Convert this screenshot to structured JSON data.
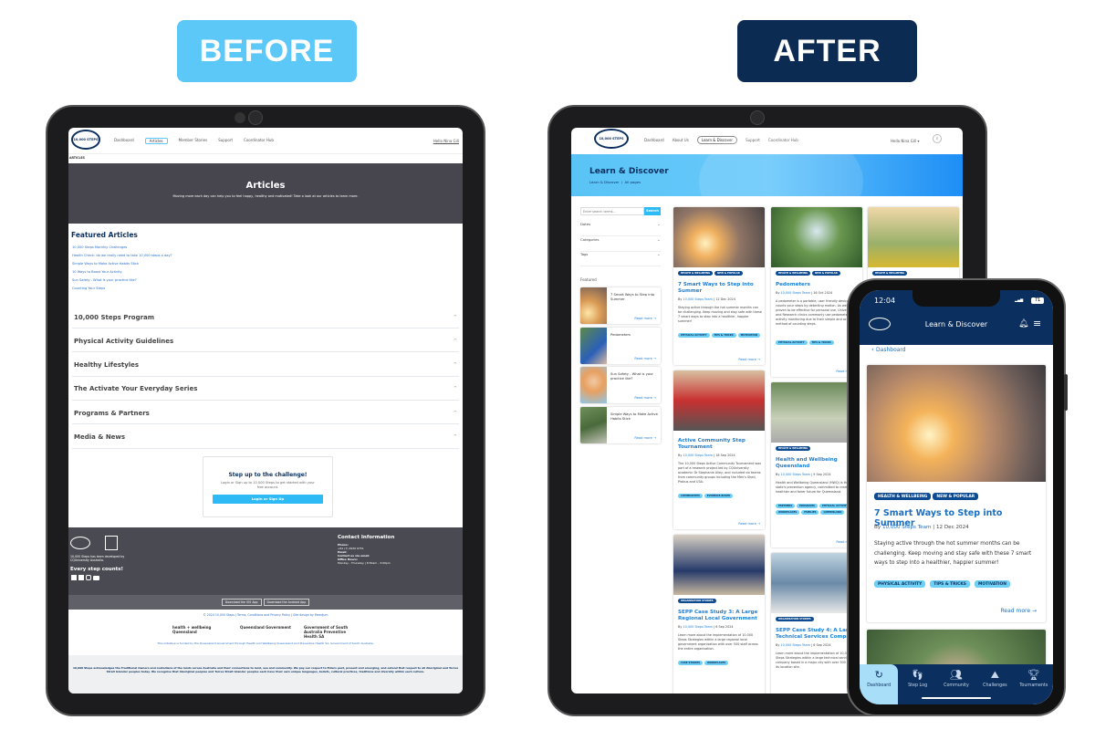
{
  "labels": {
    "before": "BEFORE",
    "after": "AFTER"
  },
  "colors": {
    "before_badge": "#5cc8f7",
    "after_badge": "#0c2b52",
    "navy": "#0b2f5e",
    "accent": "#1b7fd4",
    "cyan": "#2ebbf5",
    "dark_hero": "#47464f"
  },
  "old_site": {
    "logo": "10,000 STEPS",
    "nav": [
      "Dashboard",
      "Articles",
      "Member Stories",
      "Support",
      "Coordinator Hub"
    ],
    "user": "Hello Nina Gill",
    "breadcrumb": "ARTICLES",
    "hero": {
      "title": "Articles",
      "subtitle": "Moving more each day can help you to feel happy, healthy and motivated! Take a look at our articles to learn more."
    },
    "featured": {
      "title": "Featured Articles",
      "links": [
        "10,000 Steps Monthly Challenges",
        "Health Check: do we really need to take 10,000 steps a day?",
        "Simple Ways to Make Active Habits Stick",
        "10 Ways to Boost Your Activity",
        "Sun Safety - What is your practice like?",
        "Counting Your Steps"
      ]
    },
    "accordion": [
      "10,000 Steps Program",
      "Physical Activity Guidelines",
      "Healthy Lifestyles",
      "The Activate Your Everyday Series",
      "Programs & Partners",
      "Media & News"
    ],
    "cta": {
      "title": "Step up to the challenge!",
      "text": "Login or Sign up to 10,000 Steps to get started with your free account.",
      "button": "Login or Sign Up"
    },
    "footer": {
      "developed": "10,000 Steps has been developed by CQUniversity Australia.",
      "tagline": "Every step counts!",
      "contact_title": "Contact Information",
      "phone_label": "Phone:",
      "phone": "+61 (7) 4930 6751",
      "email_label": "Email:",
      "email": "Contact us via email",
      "hours_label": "Office Hours:",
      "hours": "Monday - Thursday | 8:30am - 3:00pm",
      "ios": "Download the iOS App",
      "android": "Download the Android App",
      "copyright": "© 2024 10,000 Steps | Terms, Conditions and Privacy Policy | Site design by Meedjum",
      "logos": [
        "health + wellbeing Queensland",
        "Queensland Government",
        "Government of South Australia Preventive Health SA"
      ],
      "funded": "This initiative is funded by the Queensland Government through Health and Wellbeing Queensland and Preventive Health SA, Government of South Australia.",
      "ack": "10,000 Steps acknowledges the Traditional Owners and custodians of the lands across Australia and their connections to land, sea and community. We pay our respect to Elders past, present and emerging, and extend that respect to all Aboriginal and Torres Strait Islander peoples today. We recognise that Aboriginal peoples and Torres Strait Islander peoples each have their own unique languages, beliefs, cultural practices, traditions and diversity within each culture."
    }
  },
  "new_site": {
    "nav": [
      "Dashboard",
      "About Us",
      "Learn & Discover",
      "Support",
      "Coordinator Hub"
    ],
    "user": "Hello Nina Gill",
    "hero": {
      "title": "Learn & Discover",
      "breadcrumb": "Learn & Discover  /  All pages"
    },
    "search": {
      "placeholder": "Enter search terms...",
      "button": "Search"
    },
    "filters": [
      "Dates",
      "Categories",
      "Tags"
    ],
    "featured_title": "Featured",
    "featured": [
      {
        "title": "7 Smart Ways to Step into Summer"
      },
      {
        "title": "Pedometers"
      },
      {
        "title": "Sun Safety - What is your practice like?"
      },
      {
        "title": "Simple Ways to Make Active Habits Stick"
      }
    ],
    "read_more": "Read more →",
    "cards": [
      {
        "tags": [
          "HEALTH & WELLBEING",
          "NEW & POPULAR"
        ],
        "title": "7 Smart Ways to Step into Summer",
        "author": "10,000 Steps Team",
        "date": "12 Dec 2024",
        "desc": "Staying active through the hot summer months can be challenging. Keep moving and stay safe with these 7 smart ways to step into a healthier, happier summer!",
        "topics": [
          "PHYSICAL ACTIVITY",
          "TIPS & TRICKS",
          "MOTIVATION"
        ]
      },
      {
        "tags": [
          "HEALTH & WELLBEING",
          "NEW & POPULAR"
        ],
        "title": "Pedometers",
        "author": "10,000 Steps Team",
        "date": "16 Oct 2024",
        "desc": "A pedometer is a portable, user friendly device that counts your steps by detecting motion. As well as proven to be effective for personal use, Universities and Research clinics commonly use pedometers for activity monitoring due to their simple and accurate method of counting steps.",
        "topics": [
          "PHYSICAL ACTIVITY",
          "TIPS & TRICKS"
        ]
      },
      {
        "tags": [
          "HEALTH & WELLBEING"
        ]
      },
      {
        "tags": [],
        "title": "Active Community Step Tournament",
        "author": "10,000 Steps Team",
        "date": "18 Sep 2024",
        "desc": "The 10,000 Steps Active Community Tournament was part of a research project led by CQUniversity academic Dr Stephanie Alley, and included six teams from community groups including the Men's Shed, Probus and U3A.",
        "topics": [
          "COMMUNITIES",
          "EVIDENCE-BASED"
        ]
      },
      {
        "tags": [
          "HEALTH & WELLBEING"
        ],
        "title": "Health and Wellbeing Queensland",
        "author": "10,000 Steps Team",
        "date": "9 Sep 2024",
        "desc": "Health and Wellbeing Queensland (HWQ) is the state's prevention agency, committed to creating a healthier and fairer future for Queensland.",
        "topics": [
          "PARTNERS",
          "PROGRAMS",
          "PHYSICAL ACTIVITY",
          "WORKPLACES",
          "FAMILIES",
          "QUEENSLAND"
        ]
      },
      {
        "tags": [
          "ORGANISATION STORIES"
        ],
        "title": "SEPP Case Study 3: A Large Regional Local Government",
        "author": "10,000 Steps Team",
        "date": "6 Sep 2024",
        "desc": "Learn more about the implementation of 10,000 Steps Strategies within a large regional local government organisation with over 500 staff across the entire organisation.",
        "topics": [
          "CASE STUDIES",
          "WORKPLACES"
        ]
      },
      {
        "tags": [
          "ORGANISATION STORIES"
        ],
        "title": "SEPP Case Study 4: A Large Technical Services Company",
        "author": "10,000 Steps Team",
        "date": "6 Sep 2024",
        "desc": "Learn more about the implementation of 10,000 Steps Strategies within a large technical services company based in a major city with over 300 staff at its location site.",
        "topics": []
      }
    ]
  },
  "phone": {
    "time": "12:04",
    "battery": "71",
    "header": "Learn & Discover",
    "back": "Dashboard",
    "card": {
      "tags": [
        "HEALTH & WELLBEING",
        "NEW & POPULAR"
      ],
      "title": "7 Smart Ways to Step into Summer",
      "author": "10,000 Steps Team",
      "date": "12 Dec 2024",
      "desc": "Staying active through the hot summer months can be challenging. Keep moving and stay safe with these 7 smart ways to step into a healthier, happier summer!",
      "topics": [
        "PHYSICAL ACTIVITY",
        "TIPS & TRICKS",
        "MOTIVATION"
      ],
      "read_more": "Read more →"
    },
    "tabs": [
      {
        "label": "Dashboard",
        "icon": "refresh-icon"
      },
      {
        "label": "Step Log",
        "icon": "footprints-icon"
      },
      {
        "label": "Community",
        "icon": "people-icon"
      },
      {
        "label": "Challenges",
        "icon": "mountain-icon"
      },
      {
        "label": "Tournaments",
        "icon": "trophy-icon"
      }
    ]
  }
}
